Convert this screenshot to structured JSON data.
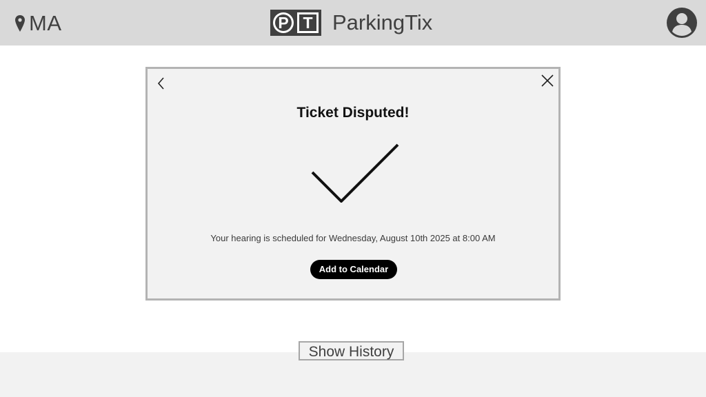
{
  "header": {
    "location": "MA",
    "logo_letters": [
      "P",
      "T"
    ],
    "brand_name": "ParkingTix",
    "avatar_icon": "user-avatar-icon",
    "location_icon": "map-pin-icon"
  },
  "modal": {
    "back_icon": "chevron-left-icon",
    "close_icon": "close-icon",
    "title": "Ticket Disputed!",
    "success_icon": "checkmark-icon",
    "message": "Your hearing is scheduled for Wednesday, August 10th 2025 at 8:00 AM",
    "calendar_button_label": "Add to Calendar"
  },
  "footer": {
    "history_button_label": "Show History"
  },
  "colors": {
    "header_bg": "#d9d9d9",
    "modal_bg": "#f2f2f2",
    "modal_border": "#b3b3b3",
    "primary_button": "#000000",
    "text_dark": "#404040"
  }
}
